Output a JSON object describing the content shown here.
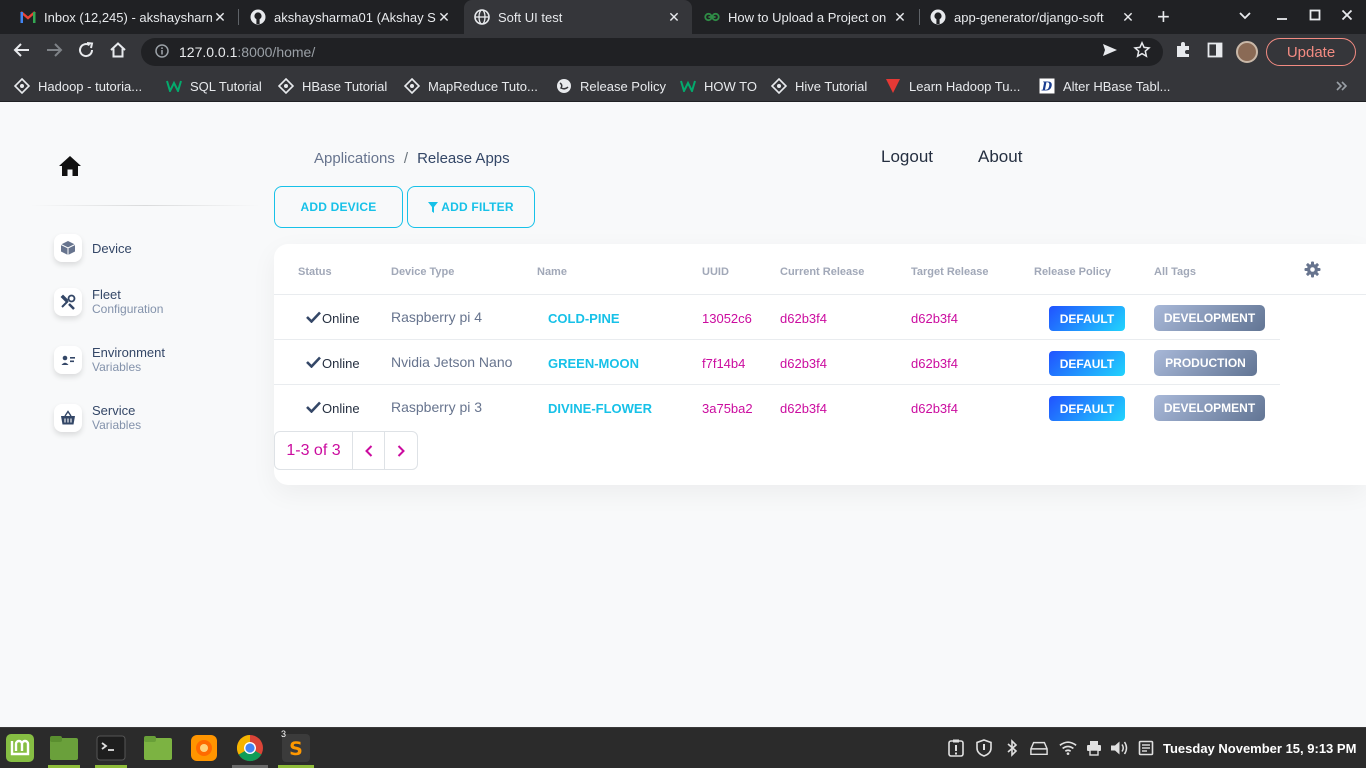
{
  "browser": {
    "tabs": [
      {
        "title": "Inbox (12,245) - akshaysharm",
        "favicon": "gmail-icon"
      },
      {
        "title": "akshaysharma01 (Akshay Sh",
        "favicon": "github-icon"
      },
      {
        "title": "Soft UI test",
        "favicon": "globe-icon",
        "active": true
      },
      {
        "title": "How to Upload a Project on",
        "favicon": "geeksforgeeks-icon"
      },
      {
        "title": "app-generator/django-soft",
        "favicon": "github-icon"
      }
    ],
    "close_glyph": "✕",
    "new_tab_glyph": "+",
    "url_host": "127.0.0.1",
    "url_path": ":8000/home/",
    "update_label": "Update",
    "bookmarks": [
      {
        "label": "Hadoop - tutoria...",
        "icon": "tutorialspoint-icon"
      },
      {
        "label": "SQL Tutorial",
        "icon": "w3schools-icon"
      },
      {
        "label": "HBase Tutorial",
        "icon": "tutorialspoint-icon"
      },
      {
        "label": "MapReduce Tuto...",
        "icon": "tutorialspoint-icon"
      },
      {
        "label": "Release Policy",
        "icon": "globe-icon"
      },
      {
        "label": "HOW TO",
        "icon": "w3schools-icon"
      },
      {
        "label": "Hive Tutorial",
        "icon": "tutorialspoint-icon"
      },
      {
        "label": "Learn Hadoop Tu...",
        "icon": "red-v-icon"
      },
      {
        "label": "Alter HBase Tabl...",
        "icon": "d-icon"
      }
    ]
  },
  "sidebar": {
    "items": [
      {
        "label": "Device",
        "sub": "",
        "icon": "box-icon"
      },
      {
        "label": "Fleet",
        "sub": "Configuration",
        "icon": "wrench-icon"
      },
      {
        "label": "Environment",
        "sub": "Variables",
        "icon": "id-card-icon"
      },
      {
        "label": "Service",
        "sub": "Variables",
        "icon": "basket-icon"
      }
    ]
  },
  "header": {
    "breadcrumb": {
      "parent": "Applications",
      "separator": "/",
      "current": "Release Apps"
    },
    "logout": "Logout",
    "about": "About"
  },
  "actions": {
    "add_device": "ADD DEVICE",
    "add_filter": "ADD FILTER"
  },
  "table": {
    "columns": [
      "Status",
      "Device Type",
      "Name",
      "UUID",
      "Current Release",
      "Target Release",
      "Release Policy",
      "All Tags"
    ],
    "rows": [
      {
        "status": "Online",
        "device_type": "Raspberry pi 4",
        "name": "COLD-PINE",
        "uuid": "13052c6",
        "current_release": "d62b3f4",
        "target_release": "d62b3f4",
        "release_policy": "DEFAULT",
        "tag": "DEVELOPMENT"
      },
      {
        "status": "Online",
        "device_type": "Nvidia Jetson Nano",
        "name": "GREEN-MOON",
        "uuid": "f7f14b4",
        "current_release": "d62b3f4",
        "target_release": "d62b3f4",
        "release_policy": "DEFAULT",
        "tag": "PRODUCTION"
      },
      {
        "status": "Online",
        "device_type": "Raspberry pi 3",
        "name": "DIVINE-FLOWER",
        "uuid": "3a75ba2",
        "current_release": "d62b3f4",
        "target_release": "d62b3f4",
        "release_policy": "DEFAULT",
        "tag": "DEVELOPMENT"
      }
    ],
    "pagination": {
      "range": "1-3 of 3",
      "prev": "‹",
      "next": "›"
    }
  },
  "taskbar": {
    "apps": [
      "mint-menu-icon",
      "files-icon",
      "terminal-icon",
      "folder-icon",
      "firefox-icon",
      "chrome-icon",
      "sublime-icon"
    ],
    "sublime_badge": "3",
    "clock": "Tuesday November 15, 9:13 PM"
  },
  "colors": {
    "accent_cyan": "#17c1e8",
    "accent_magenta": "#cb0c9f",
    "text_dark": "#344767",
    "update_red": "#f28b82"
  }
}
